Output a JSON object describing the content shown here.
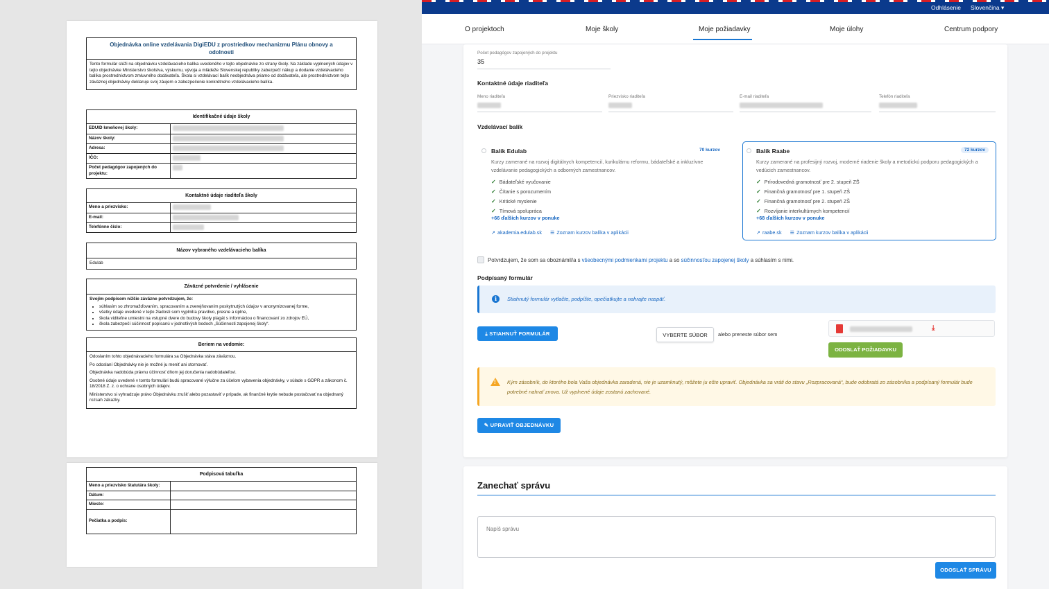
{
  "pdf": {
    "title": "Objednávka online vzdelávania DigiEDU z prostriedkov mechanizmu Plánu obnovy a odolnosti",
    "intro": "Tento formulár slúži na objednávku vzdelávacieho balíka uvedeného v tejto objednávke zo strany školy. Na základe vyplnených údajov v tejto objednávke Ministerstvo školstva, výskumu, vývoja a mládeže Slovenskej republiky zabezpečí nákup a dodanie vzdelávacieho balíka prostredníctvom zmluvného dodávateľa. Škola si vzdelávací balík neobjednáva priamo od dodávateľa, ale prostredníctvom tejto záväznej objednávky deklaruje svoj záujem o zabezpečenie konkrétneho vzdelávacieho balíka.",
    "id_section": {
      "title": "Identifikačné údaje školy",
      "rows": [
        "EDUID kmeňovej školy:",
        "Názov školy:",
        "Adresa:",
        "IČO:",
        "Počet pedagógov zapojených do projektu:"
      ]
    },
    "director_section": {
      "title": "Kontaktné údaje riaditeľa školy",
      "rows": [
        "Meno a priezvisko:",
        "E-mail:",
        "Telefónne číslo:"
      ]
    },
    "package_section": {
      "title": "Názov vybraného vzdelávacieho balíka",
      "value": "Edulab"
    },
    "confirm_section": {
      "title": "Záväzné potvrdenie / vyhlásenie",
      "lead": "Svojím podpisom nižšie záväzne potvrdzujem, že:",
      "items": [
        "súhlasím so zhromažďovaním, spracovaním a zverejňovaním poskytnutých údajov v anonymizovanej forme,",
        "všetky údaje uvedené v tejto žiadosti som vyplnil/a pravdivo, presne a úplne,",
        "škola viditeľne umiestni na vstupné dvere do budovy školy plagát s informáciou o financovaní zo zdrojov EÚ,",
        "škola zabezpečí súčinnosť popísanú v jednotlivých bodoch „Súčinnosti zapojenej školy“."
      ]
    },
    "notice_section": {
      "title": "Beriem na vedomie:",
      "paragraphs": [
        "Odoslaním tohto objednávacieho formulára sa Objednávka stáva záväznou.",
        "Po odoslaní Objednávky nie je možné ju meniť ani stornovať.",
        "Objednávka nadobúda právnu účinnosť dňom jej doručenia nadobúdateľovi.",
        "Osobné údaje uvedené v tomto formulári budú spracované výlučne za účelom vybavenia objednávky, v súlade s GDPR a zákonom č. 18/2018 Z. z. o ochrane osobných údajov.",
        "Ministerstvo si vyhradzuje právo Objednávku zrušiť alebo pozastaviť v prípade, ak finančné krytie nebude postačovať na objednaný rozsah zákazky."
      ]
    },
    "signature_section": {
      "title": "Podpisová tabuľka",
      "rows": [
        "Meno a priezvisko štatutára školy:",
        "Dátum:",
        "Miesto:",
        "Pečiatka a podpis:"
      ]
    }
  },
  "topbar": {
    "logout": "Odhlásenie",
    "language": "Slovenčina ▾"
  },
  "nav": {
    "tabs": [
      {
        "label": "O projektoch"
      },
      {
        "label": "Moje školy"
      },
      {
        "label": "Moje požiadavky"
      },
      {
        "label": "Moje úlohy"
      },
      {
        "label": "Centrum podpory"
      }
    ],
    "active_index": 2
  },
  "form": {
    "teachers_label": "Počet pedagógov zapojených do projektu",
    "teachers_value": "35",
    "director_title": "Kontaktné údaje riaditeľa",
    "director_fields": [
      "Meno riaditeľa",
      "Priezvisko riaditeľa",
      "E-mail riaditeľa",
      "Telefón riaditeľa"
    ],
    "package_title": "Vzdelávací balík",
    "packages": [
      {
        "name": "Balík Edulab",
        "count": "70 kurzov",
        "desc": "Kurzy zamerané na rozvoj digitálnych kompetencií, kurikulárnu reformu, bádateľské a inkluzívne vzdelávanie pedagogických a odborných zamestnancov.",
        "items": [
          "Bádateľské vyučovanie",
          "Čítanie s porozumením",
          "Kritické myslenie",
          "Tímová spolupráca"
        ],
        "more": "+66 ďalších kurzov v ponuke",
        "link1": "akademia.edulab.sk",
        "link2": "Zoznam kurzov balíka v aplikácii"
      },
      {
        "name": "Balík Raabe",
        "count": "72 kurzov",
        "desc": "Kurzy zamerané na profesijný rozvoj, moderné riadenie školy a metodickú podporu pedagogických a vedúcich zamestnancov.",
        "items": [
          "Prírodovedná gramotnosť pre 2. stupeň ZŠ",
          "Finančná gramotnosť pre 1. stupeň ZŠ",
          "Finančná gramotnosť pre 2. stupeň ZŠ",
          "Rozvíjanie interkultúrnych kompetencií"
        ],
        "more": "+68 ďalších kurzov v ponuke",
        "link1": "raabe.sk",
        "link2": "Zoznam kurzov balíka v aplikácii"
      }
    ],
    "agree": {
      "pre": "Potvrdzujem, že som sa oboznámil/a s ",
      "link1": "všeobecnými podmienkami projektu",
      "mid": " a so ",
      "link2": "súčinnosťou zapojenej školy",
      "post": " a súhlasím s nimi."
    },
    "signed_title": "Podpísaný formulár",
    "info_text": "Stiahnutý formulár vytlačte, podpíšte, opečiatkujte a nahrajte naspäť.",
    "download_label": "STIAHNUŤ FORMULÁR",
    "choose_file_label": "VYBERTE SÚBOR",
    "drop_text": "alebo preneste súbor sem",
    "send_request_label": "ODOSLAŤ POŽIADAVKU",
    "warning_text": "Kým zásobník, do ktorého bola Vaša objednávka zaradená, nie je uzamknutý, môžete ju ešte upraviť. Objednávka sa vráti do stavu „Rozpracovaná“, bude odobratá zo zásobníka a podpísaný formulár bude potrebné nahrať znova. Už vyplnené údaje zostanú zachované.",
    "edit_label": "UPRAVIŤ OBJEDNÁVKU"
  },
  "message": {
    "title": "Zanechať správu",
    "placeholder": "Napíš správu",
    "send_label": "ODOSLAŤ SPRÁVU"
  },
  "colors": {
    "primary": "#1e88e5",
    "success": "#7cb342",
    "warning": "#f5a623",
    "navy": "#0b3a8c"
  }
}
